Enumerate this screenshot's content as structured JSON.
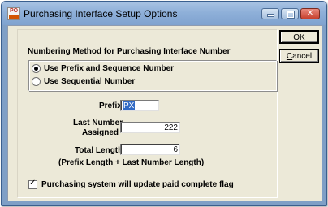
{
  "window": {
    "title": "Purchasing Interface Setup Options",
    "app_icon_text": "PO",
    "controls": {
      "minimize": "minimize",
      "maximize": "maximize",
      "close": "✕"
    }
  },
  "numbering": {
    "heading": "Numbering Method for Purchasing Interface Number",
    "options": [
      {
        "label": "Use Prefix and Sequence Number",
        "selected": true
      },
      {
        "label": "Use Sequential Number",
        "selected": false
      }
    ]
  },
  "fields": {
    "prefix_label": "Prefix",
    "prefix_value": "PX",
    "last_number_label_1": "Last Number",
    "last_number_label_2": "Assigned",
    "last_number_value": "222",
    "total_length_label": "Total Length",
    "total_length_value": "6",
    "length_note": "(Prefix Length + Last Number Length)"
  },
  "update_flag": {
    "label": "Purchasing system will update paid complete flag",
    "checked": true,
    "check_glyph": "✓"
  },
  "buttons": {
    "ok_first": "O",
    "ok_rest": "K",
    "cancel_first": "C",
    "cancel_rest": "ancel"
  }
}
